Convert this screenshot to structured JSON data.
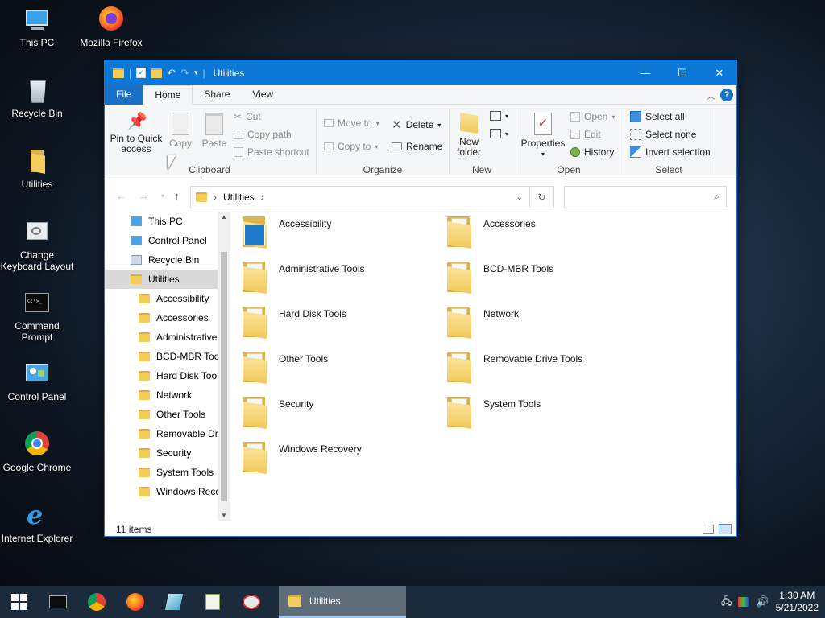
{
  "desktop": {
    "icons": [
      {
        "label": "This PC"
      },
      {
        "label": "Mozilla Firefox"
      },
      {
        "label": "Recycle Bin"
      },
      {
        "label": "Utilities"
      },
      {
        "label": "Change Keyboard Layout"
      },
      {
        "label": "Command Prompt"
      },
      {
        "label": "Control Panel"
      },
      {
        "label": "Google Chrome"
      },
      {
        "label": "Internet Explorer"
      }
    ]
  },
  "window": {
    "title": "Utilities",
    "controls": {
      "minimize": "—",
      "maximize": "☐",
      "close": "✕"
    },
    "tabs": [
      "File",
      "Home",
      "Share",
      "View"
    ],
    "ribbon": {
      "clipboard": {
        "label": "Clipboard",
        "pin": "Pin to Quick access",
        "copy": "Copy",
        "paste": "Paste",
        "cut": "Cut",
        "copy_path": "Copy path",
        "paste_shortcut": "Paste shortcut"
      },
      "organize": {
        "label": "Organize",
        "move_to": "Move to",
        "copy_to": "Copy to",
        "delete": "Delete",
        "rename": "Rename"
      },
      "new": {
        "label": "New",
        "new_folder": "New folder"
      },
      "open": {
        "label": "Open",
        "properties": "Properties",
        "open": "Open",
        "edit": "Edit",
        "history": "History"
      },
      "select": {
        "label": "Select",
        "select_all": "Select all",
        "select_none": "Select none",
        "invert_selection": "Invert selection"
      }
    },
    "address": {
      "path": "Utilities",
      "search_placeholder": ""
    },
    "nav_pane": [
      {
        "label": "This PC",
        "level": 0
      },
      {
        "label": "Control Panel",
        "level": 0
      },
      {
        "label": "Recycle Bin",
        "level": 0
      },
      {
        "label": "Utilities",
        "level": 0,
        "selected": true
      },
      {
        "label": "Accessibility",
        "level": 1
      },
      {
        "label": "Accessories",
        "level": 1
      },
      {
        "label": "Administrative",
        "level": 1
      },
      {
        "label": "BCD-MBR Tool",
        "level": 1
      },
      {
        "label": "Hard Disk Tools",
        "level": 1
      },
      {
        "label": "Network",
        "level": 1
      },
      {
        "label": "Other Tools",
        "level": 1
      },
      {
        "label": "Removable Dri",
        "level": 1
      },
      {
        "label": "Security",
        "level": 1
      },
      {
        "label": "System Tools",
        "level": 1
      },
      {
        "label": "Windows Reco",
        "level": 1
      }
    ],
    "items": [
      {
        "name": "Accessibility",
        "icon": "accessibility-icon"
      },
      {
        "name": "Accessories",
        "icon": "folder-icon"
      },
      {
        "name": "Administrative Tools",
        "icon": "folder-icon"
      },
      {
        "name": "BCD-MBR Tools",
        "icon": "folder-icon"
      },
      {
        "name": "Hard Disk Tools",
        "icon": "folder-icon"
      },
      {
        "name": "Network",
        "icon": "folder-icon"
      },
      {
        "name": "Other Tools",
        "icon": "folder-icon"
      },
      {
        "name": "Removable Drive Tools",
        "icon": "folder-icon"
      },
      {
        "name": "Security",
        "icon": "folder-icon"
      },
      {
        "name": "System Tools",
        "icon": "folder-icon"
      },
      {
        "name": "Windows Recovery",
        "icon": "folder-icon"
      }
    ],
    "status": {
      "count": "11 items"
    }
  },
  "taskbar": {
    "active_window": "Utilities",
    "time": "1:30 AM",
    "date": "5/21/2022"
  },
  "colors": {
    "accent": "#0b78d7",
    "taskbar": "#1c2b3b",
    "folder": "#f1c95a"
  }
}
